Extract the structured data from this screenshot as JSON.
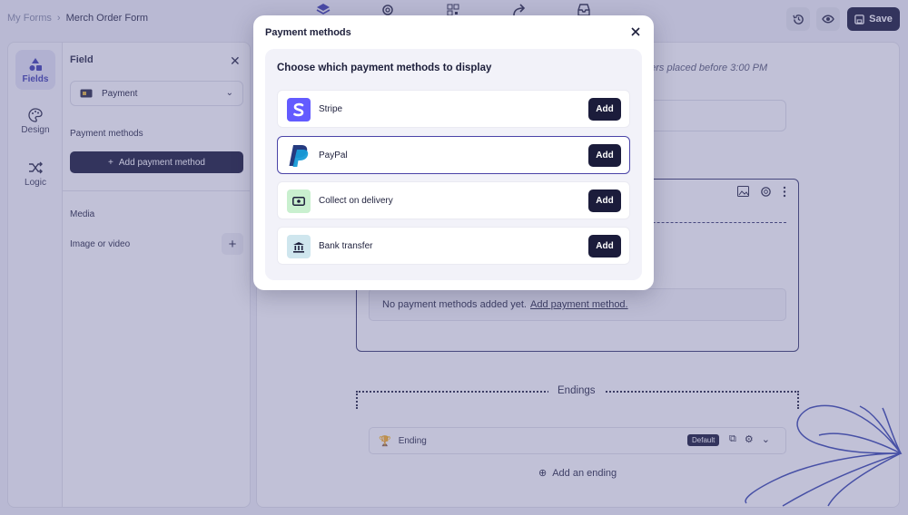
{
  "header": {
    "breadcrumbs": [
      "My Forms",
      "Merch Order Form"
    ],
    "center_icons": [
      "layers-icon",
      "gear-icon",
      "qr-grid-icon",
      "share-icon",
      "inbox-icon"
    ],
    "save_label": "Save"
  },
  "rail": {
    "items": [
      {
        "label": "Fields",
        "icon": "shapes-icon",
        "active": true
      },
      {
        "label": "Design",
        "icon": "palette-icon",
        "active": false
      },
      {
        "label": "Logic",
        "icon": "shuffle-icon",
        "active": false
      }
    ]
  },
  "panel": {
    "title": "Field",
    "field_type": "Payment",
    "payment_methods_label": "Payment methods",
    "add_payment_method_label": "Add payment method",
    "media_label": "Media",
    "image_or_video_label": "Image or video"
  },
  "canvas": {
    "note": "ders placed before 3:00 PM",
    "empty_text": "No payment methods added yet.",
    "empty_link": "Add payment method.",
    "endings_title": "Endings",
    "ending_label": "Ending",
    "default_badge": "Default",
    "add_ending_label": "Add an ending"
  },
  "modal": {
    "title": "Payment methods",
    "subtitle": "Choose which payment methods to display",
    "methods": [
      {
        "label": "Stripe",
        "add_label": "Add",
        "icon": "stripe-icon",
        "selected": false
      },
      {
        "label": "PayPal",
        "add_label": "Add",
        "icon": "paypal-icon",
        "selected": true
      },
      {
        "label": "Collect on delivery",
        "add_label": "Add",
        "icon": "cash-icon",
        "selected": false
      },
      {
        "label": "Bank transfer",
        "add_label": "Add",
        "icon": "bank-icon",
        "selected": false
      }
    ]
  },
  "colors": {
    "primary_dark": "#1b1c3b",
    "accent_purple": "#4a44a8",
    "stripe": "#635bff",
    "paypal_dark": "#253b80",
    "paypal_light": "#179bd7",
    "cod_bg": "#c9f0cf",
    "bank_bg": "#cfe6ee",
    "overlay": "#5c5c96"
  }
}
